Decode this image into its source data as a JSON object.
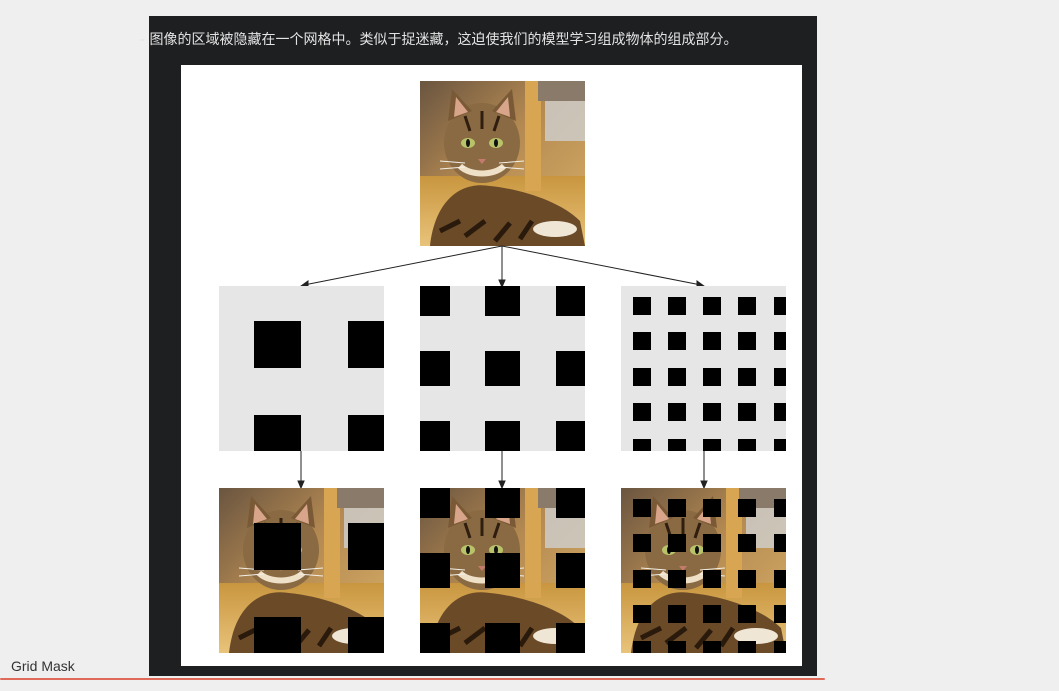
{
  "caption": "- 图像的区域被隐藏在一个网格中。类似于捉迷藏，这迫使我们的模型学习组成物体的组成部分。",
  "footer_label": "Grid Mask",
  "colors": {
    "panel_bg": "#1e1f21",
    "figure_bg": "#ffffff",
    "mask_bg": "#e6e6e6",
    "mask_square": "#000000",
    "footer_line": "#e06a5a"
  },
  "figure": {
    "source": "cat-photo",
    "mask_grids": [
      {
        "name": "coarse-grid",
        "cells": 2
      },
      {
        "name": "medium-grid",
        "cells": 3
      },
      {
        "name": "fine-grid",
        "cells": 5
      }
    ]
  }
}
